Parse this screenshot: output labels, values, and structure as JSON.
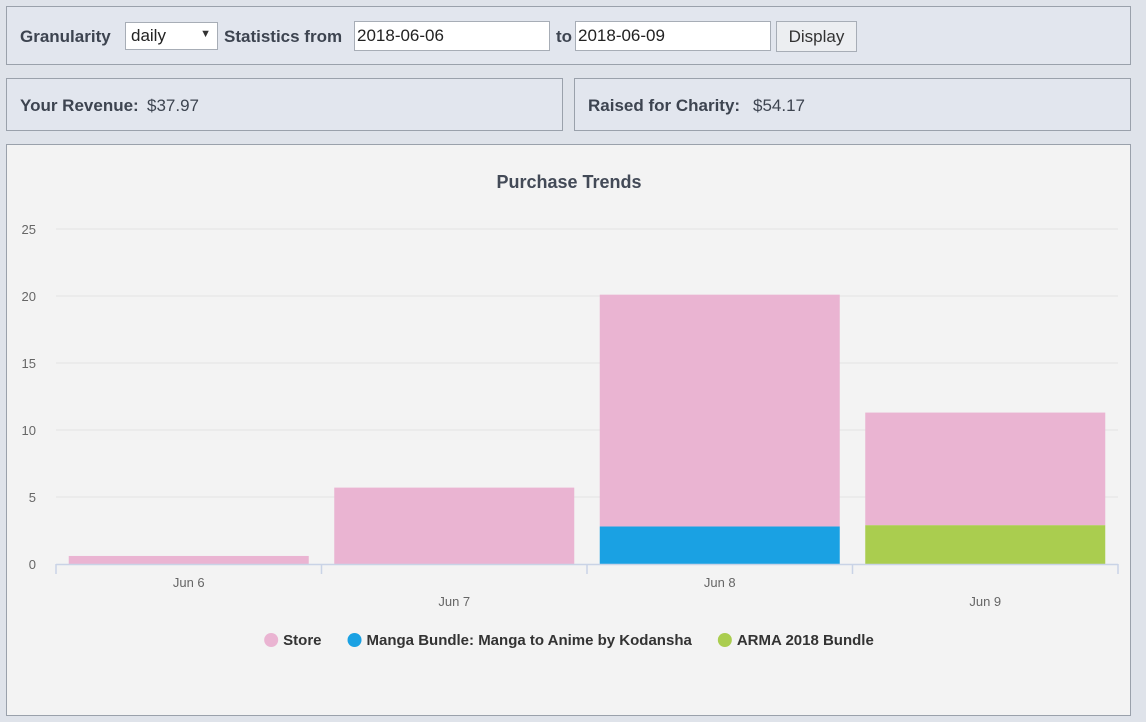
{
  "filters": {
    "granularity_label": "Granularity",
    "granularity_value": "daily",
    "stats_from_label": "Statistics from",
    "from_date": "2018-06-06",
    "to_label": "to",
    "to_date": "2018-06-09",
    "display_button": "Display"
  },
  "summary": {
    "revenue_label": "Your Revenue:",
    "revenue_value": "$37.97",
    "charity_label": "Raised for Charity:",
    "charity_value": "$54.17"
  },
  "colors": {
    "store": "#eab4d2",
    "manga": "#1aa1e3",
    "arma": "#aacd4f"
  },
  "chart_data": {
    "type": "bar",
    "stacked": true,
    "title": "Purchase Trends",
    "categories": [
      "Jun 6",
      "Jun 7",
      "Jun 8",
      "Jun 9"
    ],
    "ylim": [
      0,
      25
    ],
    "yticks": [
      0,
      5,
      10,
      15,
      20,
      25
    ],
    "grid": true,
    "legend_position": "bottom",
    "series": [
      {
        "name": "Manga Bundle: Manga to Anime by Kodansha",
        "color": "#1aa1e3",
        "values": [
          0,
          0,
          2.8,
          0
        ]
      },
      {
        "name": "ARMA 2018 Bundle",
        "color": "#aacd4f",
        "values": [
          0,
          0,
          0,
          2.9
        ]
      },
      {
        "name": "Store",
        "color": "#eab4d2",
        "values": [
          0.6,
          5.7,
          17.3,
          8.4
        ]
      }
    ],
    "legend_order": [
      "Store",
      "Manga Bundle: Manga to Anime by Kodansha",
      "ARMA 2018 Bundle"
    ]
  }
}
